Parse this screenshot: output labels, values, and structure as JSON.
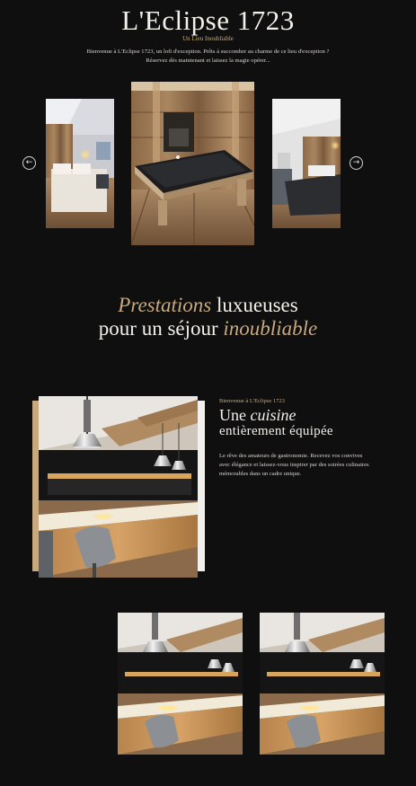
{
  "header": {
    "title": "L'Eclipse 1723",
    "subtitle": "Un Lieu Inoubliable",
    "intro_line1": "Bienvenue à L'Eclipse 1723, un loft d'exception. Prêts à succomber au charme de ce lieu d'exception ?",
    "intro_line2": "Réservez dès maintenant et laissez la magie opérer..."
  },
  "carousel": {
    "prev_icon": "←",
    "next_icon": "→"
  },
  "section": {
    "heading_em1": "Prestations",
    "heading_rest1": " luxueuses",
    "heading_line2_a": "pour un séjour ",
    "heading_em2": "inoubliable"
  },
  "feature": {
    "eyebrow": "Bienvenue à L'Eclipse 1723",
    "title_a": "Une ",
    "title_em": "cuisine",
    "title_line2": "entièrement équipée",
    "body": "Le rêve des amateurs de gastronomie. Recevez vos convives avec élégance et laissez-vous inspirer par des soirées culinaires mémorables dans un cadre unique."
  },
  "colors": {
    "background": "#0f0f0f",
    "accent": "#c8a97e",
    "text": "#f3efe9"
  }
}
